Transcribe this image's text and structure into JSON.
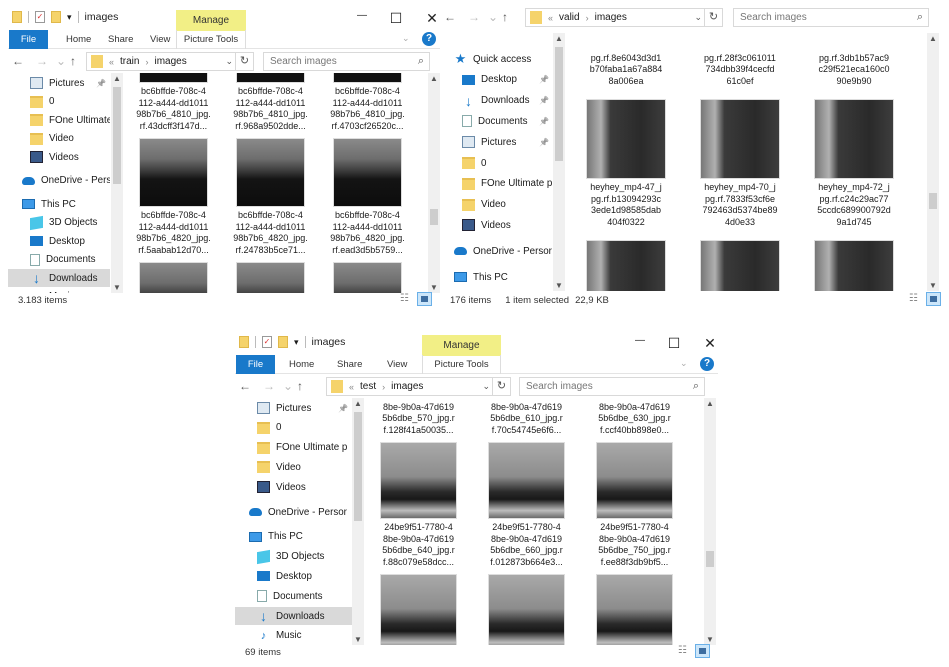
{
  "windows": [
    {
      "title": "images",
      "manage": "Manage",
      "tabs": {
        "file": "File",
        "home": "Home",
        "share": "Share",
        "view": "View",
        "picture_tools": "Picture Tools"
      },
      "path": {
        "prefix": "«",
        "parent": "train",
        "current": "images"
      },
      "search_placeholder": "Search images",
      "sidebar": [
        {
          "label": "Pictures",
          "icon": "pictures",
          "pinned": true,
          "indent": 1
        },
        {
          "label": "0",
          "icon": "folder",
          "indent": 1
        },
        {
          "label": "FOne Ultimate p",
          "icon": "folder",
          "indent": 1
        },
        {
          "label": "Video",
          "icon": "folder",
          "indent": 1
        },
        {
          "label": "Videos",
          "icon": "videos",
          "indent": 1
        },
        {
          "label": "OneDrive - Persor",
          "icon": "onedrive",
          "indent": 0,
          "gap": true
        },
        {
          "label": "This PC",
          "icon": "pc",
          "indent": 0,
          "gap": true
        },
        {
          "label": "3D Objects",
          "icon": "3d",
          "indent": 1
        },
        {
          "label": "Desktop",
          "icon": "desktop",
          "indent": 1
        },
        {
          "label": "Documents",
          "icon": "docs",
          "indent": 1
        },
        {
          "label": "Downloads",
          "icon": "down",
          "indent": 1,
          "selected": true
        },
        {
          "label": "Music",
          "icon": "music",
          "indent": 1
        }
      ],
      "tiles": [
        {
          "lines": [
            "bc6bffde-708c-4",
            "112-a444-dd1011",
            "98b7b6_4810_jpg.",
            "rf.43dcff3f147d..."
          ]
        },
        {
          "lines": [
            "bc6bffde-708c-4",
            "112-a444-dd1011",
            "98b7b6_4810_jpg.",
            "rf.968a9502dde..."
          ]
        },
        {
          "lines": [
            "bc6bffde-708c-4",
            "112-a444-dd1011",
            "98b7b6_4810_jpg.",
            "rf.4703cf26520c..."
          ]
        },
        {
          "lines": [
            "bc6bffde-708c-4",
            "112-a444-dd1011",
            "98b7b6_4820_jpg.",
            "rf.5aabab12d70..."
          ]
        },
        {
          "lines": [
            "bc6bffde-708c-4",
            "112-a444-dd1011",
            "98b7b6_4820_jpg.",
            "rf.24783b5ce71..."
          ]
        },
        {
          "lines": [
            "bc6bffde-708c-4",
            "112-a444-dd1011",
            "98b7b6_4820_jpg.",
            "rf.ead3d5b5759..."
          ]
        },
        {
          "lines": []
        },
        {
          "lines": []
        },
        {
          "lines": []
        }
      ],
      "status": {
        "count": "3.183 items"
      }
    },
    {
      "path": {
        "prefix": "«",
        "parent": "valid",
        "current": "images"
      },
      "search_placeholder": "Search images",
      "sidebar": [
        {
          "label": "Quick access",
          "icon": "star",
          "indent": 0
        },
        {
          "label": "Desktop",
          "icon": "desktop",
          "pinned": true,
          "indent": 1
        },
        {
          "label": "Downloads",
          "icon": "down",
          "pinned": true,
          "indent": 1
        },
        {
          "label": "Documents",
          "icon": "docs",
          "pinned": true,
          "indent": 1
        },
        {
          "label": "Pictures",
          "icon": "pictures",
          "pinned": true,
          "indent": 1
        },
        {
          "label": "0",
          "icon": "folder",
          "indent": 1
        },
        {
          "label": "FOne Ultimate p",
          "icon": "folder",
          "indent": 1
        },
        {
          "label": "Video",
          "icon": "folder",
          "indent": 1
        },
        {
          "label": "Videos",
          "icon": "videos",
          "indent": 1
        },
        {
          "label": "OneDrive - Persor",
          "icon": "onedrive",
          "indent": 0,
          "gap": true
        },
        {
          "label": "This PC",
          "icon": "pc",
          "indent": 0,
          "gap": true
        }
      ],
      "tiles": [
        {
          "lines": [
            "pg.rf.8e6043d3d1",
            "b70faba1a67a884",
            "8a006ea"
          ]
        },
        {
          "lines": [
            "pg.rf.28f3c061011",
            "734dbb39f4cecfd",
            "61c0ef"
          ]
        },
        {
          "lines": [
            "pg.rf.3db1b57ac9",
            "c29f521eca160c0",
            "90e9b90"
          ]
        },
        {
          "lines": [
            "heyhey_mp4-47_j",
            "pg.rf.b13094293c",
            "3ede1d98585dab",
            "404f0322"
          ]
        },
        {
          "lines": [
            "heyhey_mp4-70_j",
            "pg.rf.7833f53cf6e",
            "792463d5374be89",
            "4d0e33"
          ]
        },
        {
          "lines": [
            "heyhey_mp4-72_j",
            "pg.rf.c24c29ac77",
            "5ccdc689900792d",
            "9a1d745"
          ]
        },
        {
          "lines": []
        },
        {
          "lines": []
        },
        {
          "lines": []
        }
      ],
      "status": {
        "count": "176 items",
        "selected": "1 item selected",
        "size": "22,9 KB"
      }
    },
    {
      "title": "images",
      "manage": "Manage",
      "tabs": {
        "file": "File",
        "home": "Home",
        "share": "Share",
        "view": "View",
        "picture_tools": "Picture Tools"
      },
      "path": {
        "prefix": "«",
        "parent": "test",
        "current": "images"
      },
      "search_placeholder": "Search images",
      "sidebar": [
        {
          "label": "Pictures",
          "icon": "pictures",
          "pinned": true,
          "indent": 1
        },
        {
          "label": "0",
          "icon": "folder",
          "indent": 1
        },
        {
          "label": "FOne Ultimate p",
          "icon": "folder",
          "indent": 1
        },
        {
          "label": "Video",
          "icon": "folder",
          "indent": 1
        },
        {
          "label": "Videos",
          "icon": "videos",
          "indent": 1
        },
        {
          "label": "OneDrive - Persor",
          "icon": "onedrive",
          "indent": 0,
          "gap": true
        },
        {
          "label": "This PC",
          "icon": "pc",
          "indent": 0,
          "gap": true
        },
        {
          "label": "3D Objects",
          "icon": "3d",
          "indent": 1
        },
        {
          "label": "Desktop",
          "icon": "desktop",
          "indent": 1
        },
        {
          "label": "Documents",
          "icon": "docs",
          "indent": 1
        },
        {
          "label": "Downloads",
          "icon": "down",
          "indent": 1,
          "selected": true
        },
        {
          "label": "Music",
          "icon": "music",
          "indent": 1
        }
      ],
      "tiles": [
        {
          "lines": [
            "8be-9b0a-47d619",
            "5b6dbe_570_jpg.r",
            "f.128f41a50035..."
          ]
        },
        {
          "lines": [
            "8be-9b0a-47d619",
            "5b6dbe_610_jpg.r",
            "f.70c54745e6f6..."
          ]
        },
        {
          "lines": [
            "8be-9b0a-47d619",
            "5b6dbe_630_jpg.r",
            "f.ccf40bb898e0..."
          ]
        },
        {
          "lines": [
            "24be9f51-7780-4",
            "8be-9b0a-47d619",
            "5b6dbe_640_jpg.r",
            "f.88c079e58dcc..."
          ]
        },
        {
          "lines": [
            "24be9f51-7780-4",
            "8be-9b0a-47d619",
            "5b6dbe_660_jpg.r",
            "f.012873b664e3..."
          ]
        },
        {
          "lines": [
            "24be9f51-7780-4",
            "8be-9b0a-47d619",
            "5b6dbe_750_jpg.r",
            "f.ee88f3db9bf5..."
          ]
        },
        {
          "lines": []
        },
        {
          "lines": []
        },
        {
          "lines": []
        }
      ],
      "status": {
        "count": "69 items"
      }
    }
  ]
}
